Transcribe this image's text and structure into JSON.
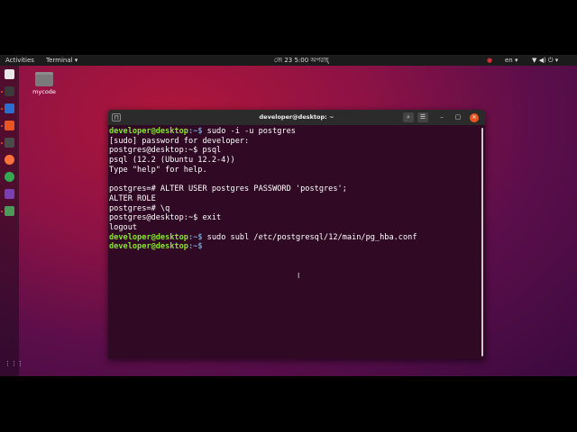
{
  "topbar": {
    "activities": "Activities",
    "app_menu": "Terminal ▾",
    "clock": "জে 23  5:00 অপরাহ্",
    "lang": "en ▾",
    "status_icons": "▼ ◀) ⏻ ▾"
  },
  "desktop": {
    "folder_label": "mycode"
  },
  "dock": {
    "items": [
      "files",
      "terminal",
      "text-editor",
      "software",
      "sublime-text",
      "firefox",
      "chrome",
      "screen-recorder",
      "app"
    ],
    "show_apps": "⋮⋮⋮"
  },
  "terminal": {
    "title": "developer@desktop: ~",
    "buttons": {
      "menu": "☰",
      "search": "⌕",
      "minimize": "–",
      "maximize": "▢",
      "close": "✕"
    },
    "lines": [
      {
        "user": "developer@desktop",
        "path": ":~$",
        "cmd": " sudo -i -u postgres"
      },
      {
        "text": "[sudo] password for developer:"
      },
      {
        "text": "postgres@desktop:~$ psql"
      },
      {
        "text": "psql (12.2 (Ubuntu 12.2-4))"
      },
      {
        "text": "Type \"help\" for help."
      },
      {
        "text": ""
      },
      {
        "text": "postgres=# ALTER USER postgres PASSWORD 'postgres';"
      },
      {
        "text": "ALTER ROLE"
      },
      {
        "text": "postgres=# \\q"
      },
      {
        "text": "postgres@desktop:~$ exit"
      },
      {
        "text": "logout"
      },
      {
        "user": "developer@desktop",
        "path": ":~$",
        "cmd": " sudo subl /etc/postgresql/12/main/pg_hba.conf"
      },
      {
        "user": "developer@desktop",
        "path": ":~$",
        "cmd": " "
      }
    ]
  }
}
